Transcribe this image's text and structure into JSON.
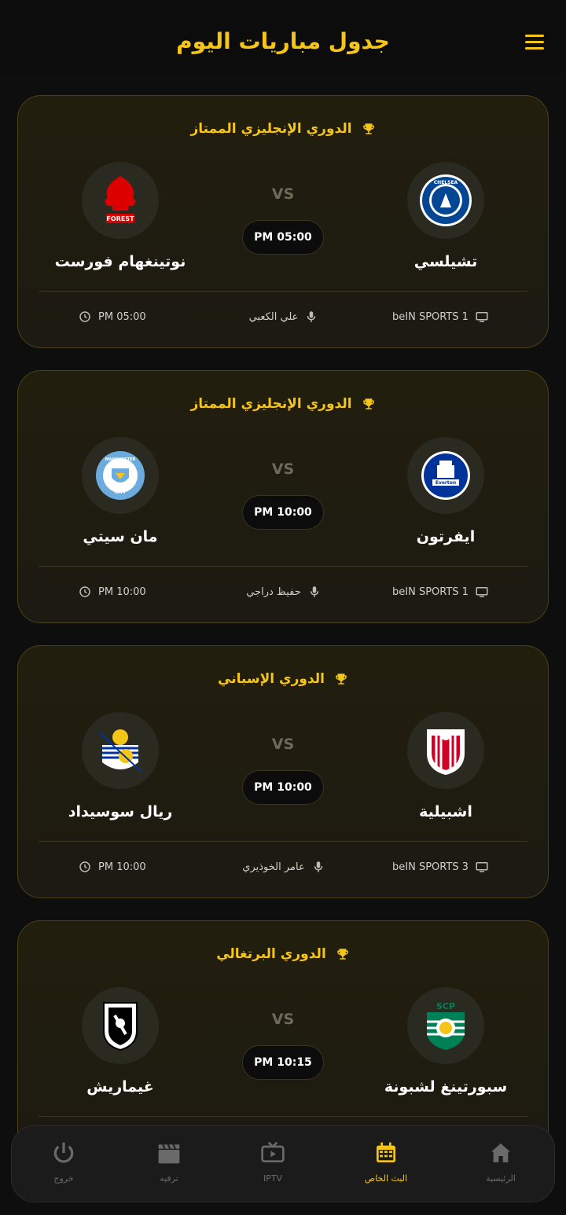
{
  "header": {
    "title": "جدول مباريات اليوم",
    "menu_icon": "hamburger-menu-icon"
  },
  "matches": [
    {
      "league": "الدوري الإنجليزي الممتاز",
      "home": "تشيلسي",
      "away": "نوتينغهام فورست",
      "vs": "VS",
      "time": "PM 05:00",
      "channel": "beIN SPORTS 1",
      "commentator": "علي الكعبي",
      "kickoff": "PM 05:00"
    },
    {
      "league": "الدوري الإنجليزي الممتاز",
      "home": "ايفرتون",
      "away": "مان سيتي",
      "vs": "VS",
      "time": "PM 10:00",
      "channel": "beIN SPORTS 1",
      "commentator": "حفيظ دراجي",
      "kickoff": "PM 10:00"
    },
    {
      "league": "الدوري الإسباني",
      "home": "اشبيلية",
      "away": "ريال سوسيداد",
      "vs": "VS",
      "time": "PM 10:00",
      "channel": "beIN SPORTS 3",
      "commentator": "عامر الخوذيري",
      "kickoff": "PM 10:00"
    },
    {
      "league": "الدوري البرتغالي",
      "home": "سبورتينغ لشبونة",
      "away": "غيماريش",
      "vs": "VS",
      "time": "PM 10:15"
    }
  ],
  "nav": {
    "home": "الرئيسية",
    "live": "البث الخاص",
    "iptv": "IPTV",
    "entertainment": "ترفيه",
    "exit": "خروج"
  },
  "colors": {
    "accent": "#f5c518",
    "background": "#0e0e0e",
    "card": "#1f1c10"
  }
}
